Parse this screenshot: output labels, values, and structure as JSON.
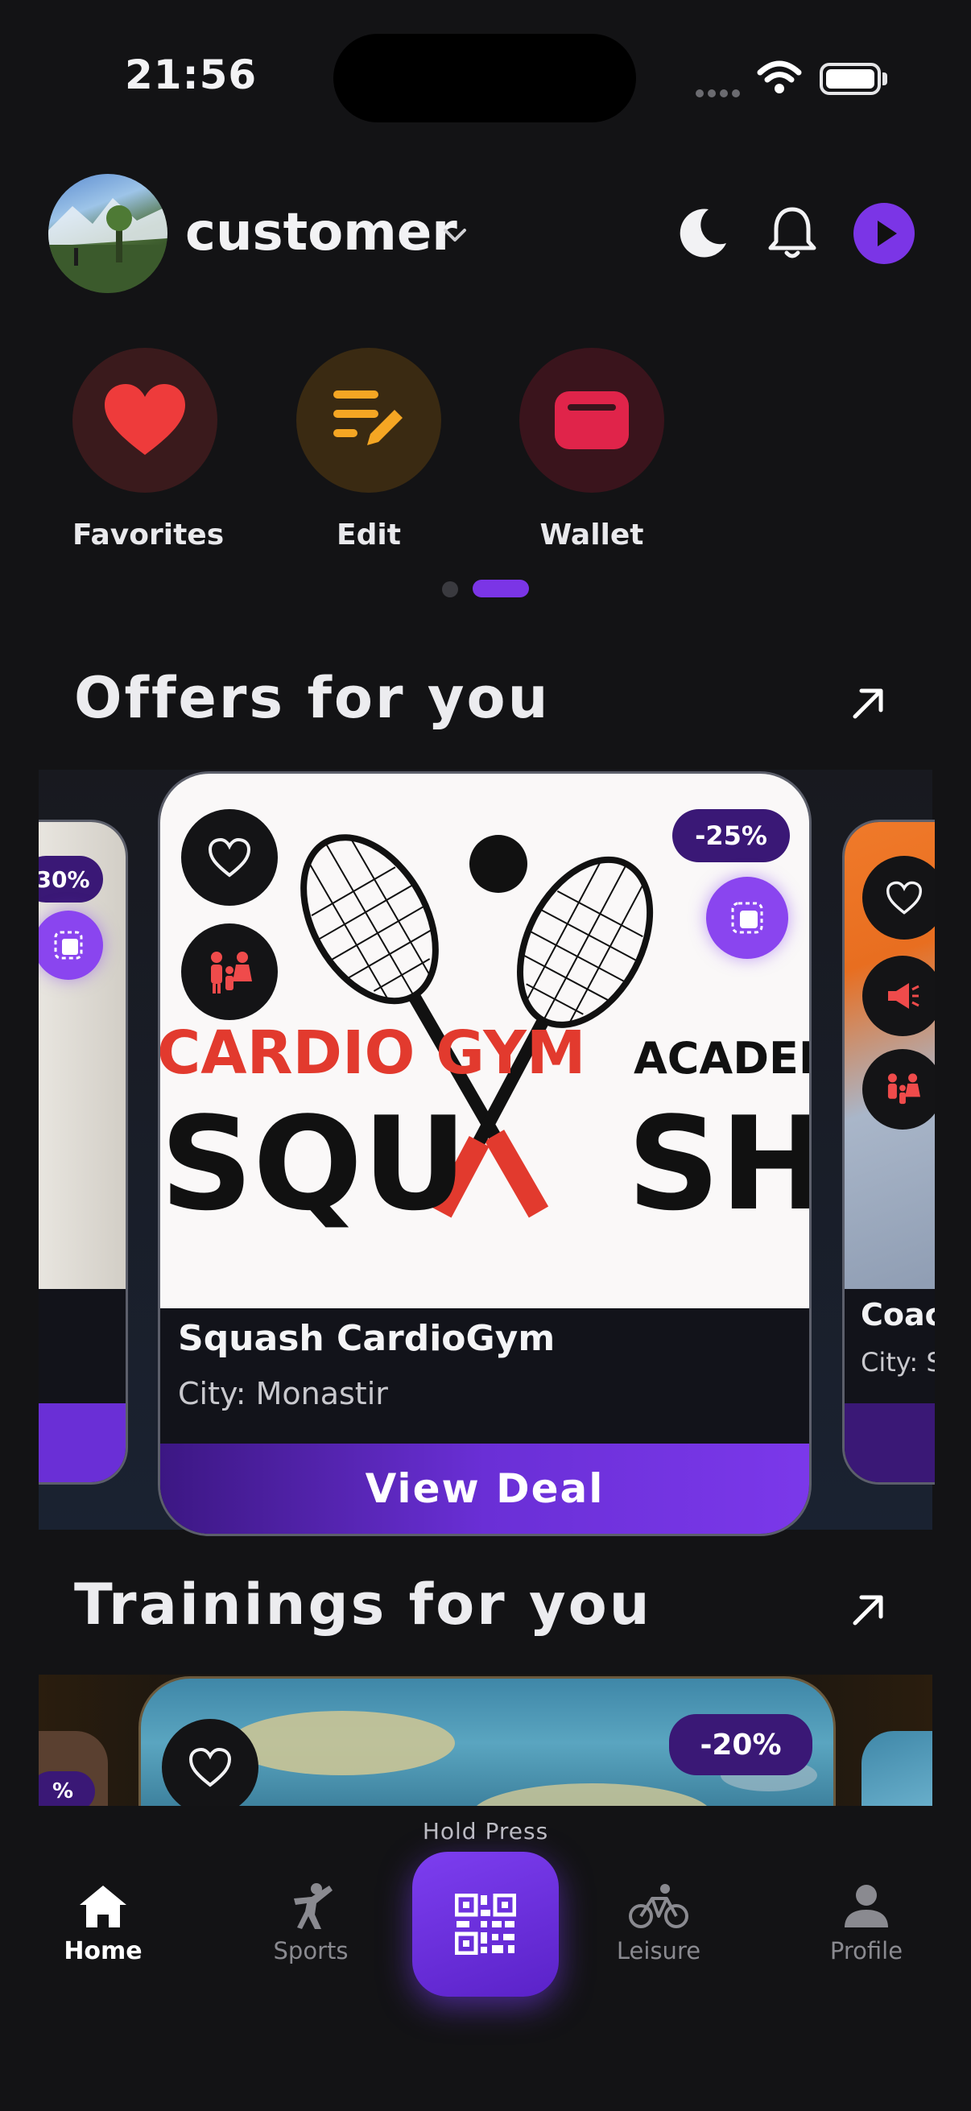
{
  "status_bar": {
    "time": "21:56"
  },
  "header": {
    "username": "customer"
  },
  "quick_actions": [
    {
      "label": "Favorites",
      "icon": "heart-icon",
      "bg": "#3a1a1c",
      "color": "#ee3b3b"
    },
    {
      "label": "Edit",
      "icon": "edit-icon",
      "bg": "#3a2a12",
      "color": "#f5a623"
    },
    {
      "label": "Wallet",
      "icon": "wallet-icon",
      "bg": "#3a141c",
      "color": "#e0244a"
    }
  ],
  "offers": {
    "title": "Offers for you",
    "left_discount": "30%",
    "main_card": {
      "discount": "-25%",
      "name": "Squash CardioGym",
      "city": "City: Monastir",
      "button": "View Deal",
      "image_text": {
        "line1": "CARDIO GYM",
        "academy": "ACADEMY",
        "left": "SQU",
        "right": "SH"
      }
    },
    "right_card": {
      "name": "Coac",
      "city": "City: S"
    }
  },
  "trainings": {
    "title": "Trainings for you",
    "left_discount": "%",
    "main_discount": "-20%"
  },
  "bottom_nav": {
    "hold_label": "Hold Press",
    "items": [
      {
        "label": "Home",
        "active": true
      },
      {
        "label": "Sports",
        "active": false
      },
      {
        "label": "Leisure",
        "active": false
      },
      {
        "label": "Profile",
        "active": false
      }
    ]
  },
  "colors": {
    "accent": "#7b35e6",
    "background": "#131315"
  }
}
